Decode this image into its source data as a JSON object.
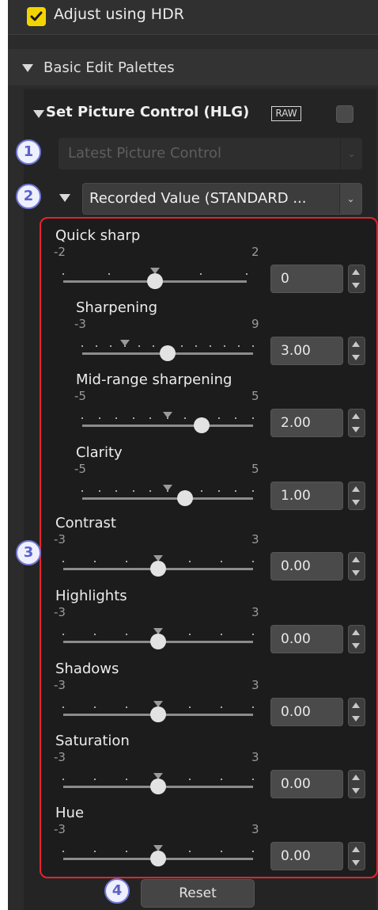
{
  "adjust_hdr": {
    "label": "Adjust using HDR",
    "checked": true
  },
  "basic_edit": {
    "label": "Basic Edit Palettes"
  },
  "set_picture_control": {
    "title": "Set Picture Control (HLG)",
    "raw_badge": "RAW",
    "checked": false,
    "picture_control_dropdown": {
      "value": "Latest Picture Control",
      "disabled": true
    },
    "mode_dropdown": {
      "value": "Recorded Value (STANDARD ..."
    }
  },
  "callouts": [
    "1",
    "2",
    "3",
    "4"
  ],
  "sliders": [
    {
      "label": "Quick sharp",
      "min": "-2",
      "max": "2",
      "value": "0"
    },
    {
      "label": "Sharpening",
      "min": "-3",
      "max": "9",
      "value": "3.00"
    },
    {
      "label": "Mid-range sharpening",
      "min": "-5",
      "max": "5",
      "value": "2.00"
    },
    {
      "label": "Clarity",
      "min": "-5",
      "max": "5",
      "value": "1.00"
    },
    {
      "label": "Contrast",
      "min": "-3",
      "max": "3",
      "value": "0.00"
    },
    {
      "label": "Highlights",
      "min": "-3",
      "max": "3",
      "value": "0.00"
    },
    {
      "label": "Shadows",
      "min": "-3",
      "max": "3",
      "value": "0.00"
    },
    {
      "label": "Saturation",
      "min": "-3",
      "max": "3",
      "value": "0.00"
    },
    {
      "label": "Hue",
      "min": "-3",
      "max": "3",
      "value": "0.00"
    }
  ],
  "reset_label": "Reset",
  "colors": {
    "accent_check": "#f4d400",
    "callout_border": "#6f76d6",
    "highlight_box": "#e4232f"
  }
}
